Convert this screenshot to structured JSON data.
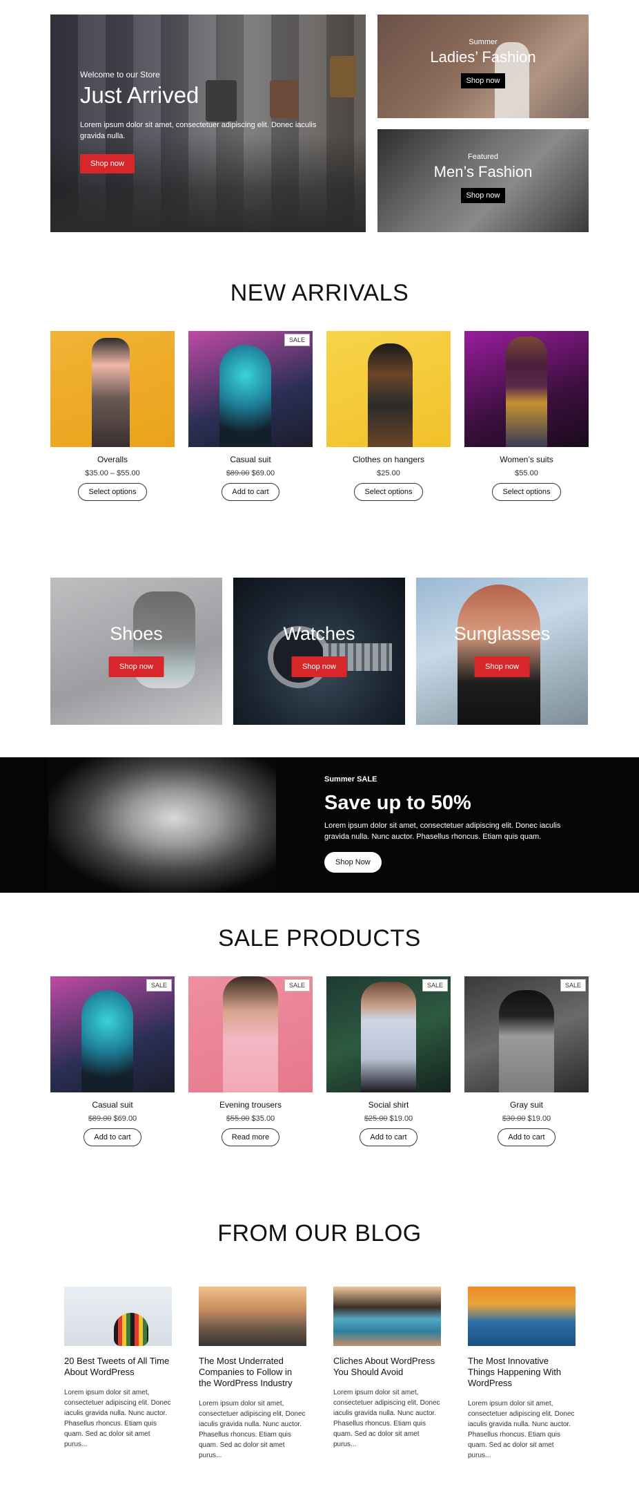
{
  "hero": {
    "welcome": "Welcome to our Store",
    "title": "Just Arrived",
    "text": "Lorem ipsum dolor sit amet, consectetuer adipiscing elit. Donec iaculis gravida nulla.",
    "button": "Shop now"
  },
  "side_banners": [
    {
      "sub": "Summer",
      "title": "Ladies’ Fashion",
      "button": "Shop now"
    },
    {
      "sub": "Featured",
      "title": "Men’s Fashion",
      "button": "Shop now"
    }
  ],
  "new_arrivals": {
    "title": "NEW ARRIVALS",
    "products": [
      {
        "name": "Overalls",
        "price": "$35.00 – $55.00",
        "old": "",
        "button": "Select options",
        "sale": ""
      },
      {
        "name": "Casual suit",
        "price": "$69.00",
        "old": "$89.00",
        "button": "Add to cart",
        "sale": "SALE"
      },
      {
        "name": "Clothes on hangers",
        "price": "$25.00",
        "old": "",
        "button": "Select options",
        "sale": ""
      },
      {
        "name": "Women’s suits",
        "price": "$55.00",
        "old": "",
        "button": "Select options",
        "sale": ""
      }
    ]
  },
  "categories": [
    {
      "title": "Shoes",
      "button": "Shop now"
    },
    {
      "title": "Watches",
      "button": "Shop now"
    },
    {
      "title": "Sunglasses",
      "button": "Shop now"
    }
  ],
  "promo": {
    "sub": "Summer SALE",
    "title": "Save up to 50%",
    "text": "Lorem ipsum dolor sit amet, consectetuer adipiscing elit. Donec iaculis gravida nulla. Nunc auctor. Phasellus rhoncus. Etiam quis quam.",
    "button": "Shop Now"
  },
  "sale_products": {
    "title": "SALE PRODUCTS",
    "products": [
      {
        "name": "Casual suit",
        "price": "$69.00",
        "old": "$89.00",
        "button": "Add to cart",
        "sale": "SALE"
      },
      {
        "name": "Evening trousers",
        "price": "$35.00",
        "old": "$55.00",
        "button": "Read more",
        "sale": "SALE"
      },
      {
        "name": "Social shirt",
        "price": "$19.00",
        "old": "$25.00",
        "button": "Add to cart",
        "sale": "SALE"
      },
      {
        "name": "Gray suit",
        "price": "$19.00",
        "old": "$30.00",
        "button": "Add to cart",
        "sale": "SALE"
      }
    ]
  },
  "blog": {
    "title": "FROM OUR BLOG",
    "posts": [
      {
        "title": "20 Best Tweets of All Time About WordPress",
        "excerpt": "Lorem ipsum dolor sit amet, consectetuer adipiscing elit. Donec iaculis gravida nulla. Nunc auctor. Phasellus rhoncus. Etiam quis quam. Sed ac dolor sit amet purus..."
      },
      {
        "title": "The Most Underrated Companies to Follow in the WordPress Industry",
        "excerpt": "Lorem ipsum dolor sit amet, consectetuer adipiscing elit. Donec iaculis gravida nulla. Nunc auctor. Phasellus rhoncus. Etiam quis quam. Sed ac dolor sit amet purus..."
      },
      {
        "title": "Cliches About WordPress You Should Avoid",
        "excerpt": "Lorem ipsum dolor sit amet, consectetuer adipiscing elit. Donec iaculis gravida nulla. Nunc auctor. Phasellus rhoncus. Etiam quis quam. Sed ac dolor sit amet purus..."
      },
      {
        "title": "The Most Innovative Things Happening With WordPress",
        "excerpt": "Lorem ipsum dolor sit amet, consectetuer adipiscing elit. Donec iaculis gravida nulla. Nunc auctor. Phasellus rhoncus. Etiam quis quam. Sed ac dolor sit amet purus..."
      }
    ]
  },
  "colors": {
    "accent": "#d8272b",
    "dark": "#000000"
  }
}
